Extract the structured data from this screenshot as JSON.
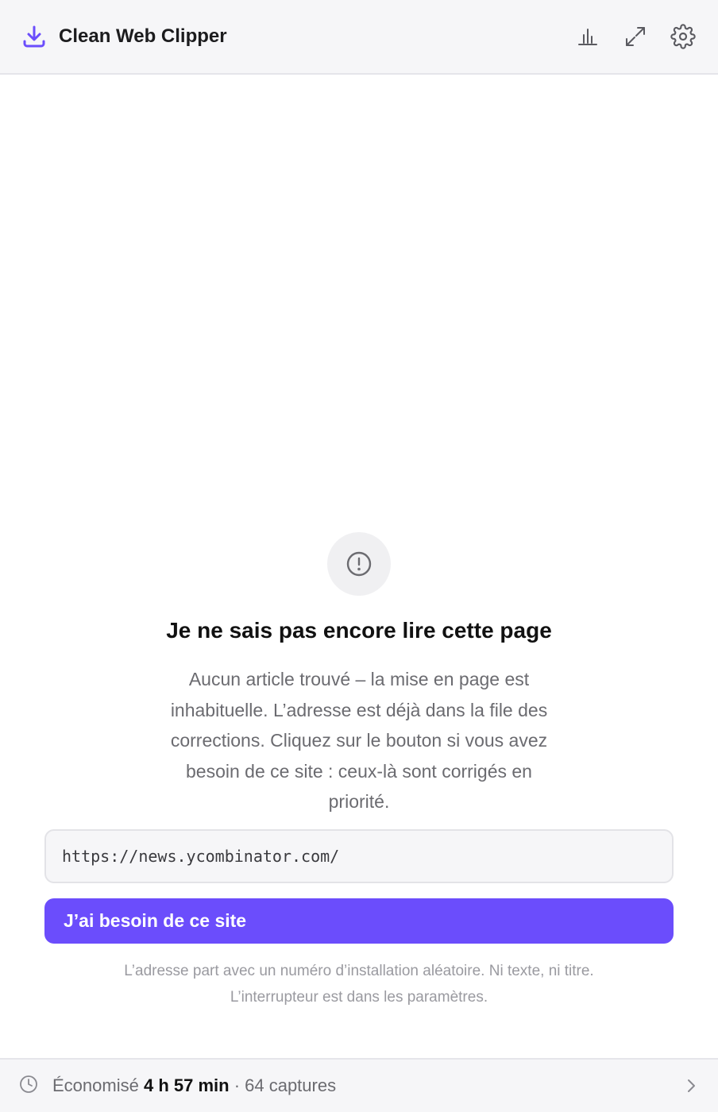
{
  "header": {
    "title": "Clean Web Clipper",
    "icons": [
      "download-icon",
      "stats-icon",
      "expand-icon",
      "settings-icon"
    ],
    "accent_color": "#6b4dfc"
  },
  "empty_state": {
    "icon": "alert-circle-icon",
    "title": "Je ne sais pas encore lire cette page",
    "description": "Aucun article trouvé – la mise en page est inhabituelle. L’adresse est déjà dans la file des corrections. Cliquez sur le bouton si vous avez besoin de ce site : ceux-là sont corrigés en priorité."
  },
  "url": "https://news.ycombinator.com/",
  "need_button_label": "J’ai besoin de ce site",
  "privacy_line1": "L’adresse part avec un numéro d’installation aléatoire. Ni texte, ni titre.",
  "privacy_line2": "L’interrupteur est dans les paramètres.",
  "footer": {
    "prefix": "Économisé",
    "saved_time": "4 h 57 min",
    "separator_captures": "· 64 captures",
    "icons": [
      "clock-icon",
      "chevron-right-icon"
    ]
  }
}
